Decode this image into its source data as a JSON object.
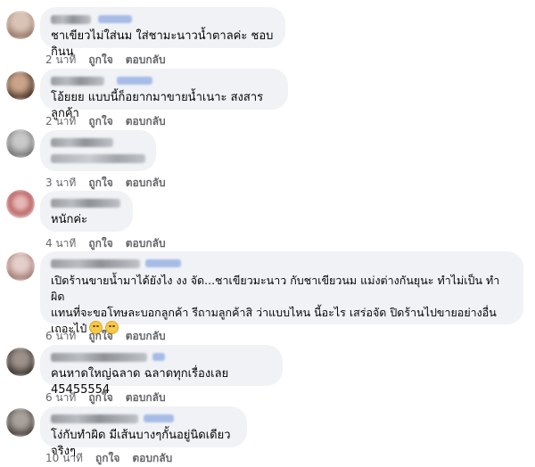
{
  "comments": [
    {
      "text": "ชาเขียวไม่ใส่นม ใส่ชามะนาวน้ำตาลค่ะ ชอบกินน",
      "time": "2 นาที",
      "like": "ถูกใจ",
      "reply": "ตอบกลับ",
      "avatar_color": "#b89a8a"
    },
    {
      "text": "โอ้ยยย แบบนี้ก็อยากมาขายน้ำเนาะ สงสารลูกค้า",
      "time": "2 นาที",
      "like": "ถูกใจ",
      "reply": "ตอบกลับ",
      "avatar_color": "#6b4e3d"
    },
    {
      "text": "",
      "time": "3 นาที",
      "like": "ถูกใจ",
      "reply": "ตอบกลับ",
      "avatar_color": "#8c8c8c"
    },
    {
      "text": "หนักค่ะ",
      "time": "4 นาที",
      "like": "ถูกใจ",
      "reply": "ตอบกลับ",
      "avatar_color": "#c06a6a"
    },
    {
      "text": "เปิดร้านขายน้ำมาได้ยังไง งง จัด...ชาเขียวมะนาว กับชาเขียวนม แม่งต่างกันยุนะ ทำไม่เป็น ทำผิด\nแทนที่จะขอโทษละบอกลูกค้า รีถามลูกค้าสิ ว่าแบบไหน นี้อะไร เสร่อจัด ปิดร้านไปขายอย่างอื่น\nเถอะไป๋",
      "time": "6 นาที",
      "like": "ถูกใจ",
      "reply": "ตอบกลับ",
      "avatar_color": "#b48c86"
    },
    {
      "text": "คนหาดใหญ่ฉลาด ฉลาดทุกเรื่องเลย 45455554",
      "time": "6 นาที",
      "like": "ถูกใจ",
      "reply": "ตอบกลับ",
      "avatar_color": "#5a5048"
    },
    {
      "text": "โง่กับทำผิด มีเส้นบางๆกั้นอยู่นิดเดียวจริงๆ",
      "time": "10 นาที",
      "like": "ถูกใจ",
      "reply": "ตอบกลับ",
      "avatar_color": "#6e6660"
    }
  ]
}
